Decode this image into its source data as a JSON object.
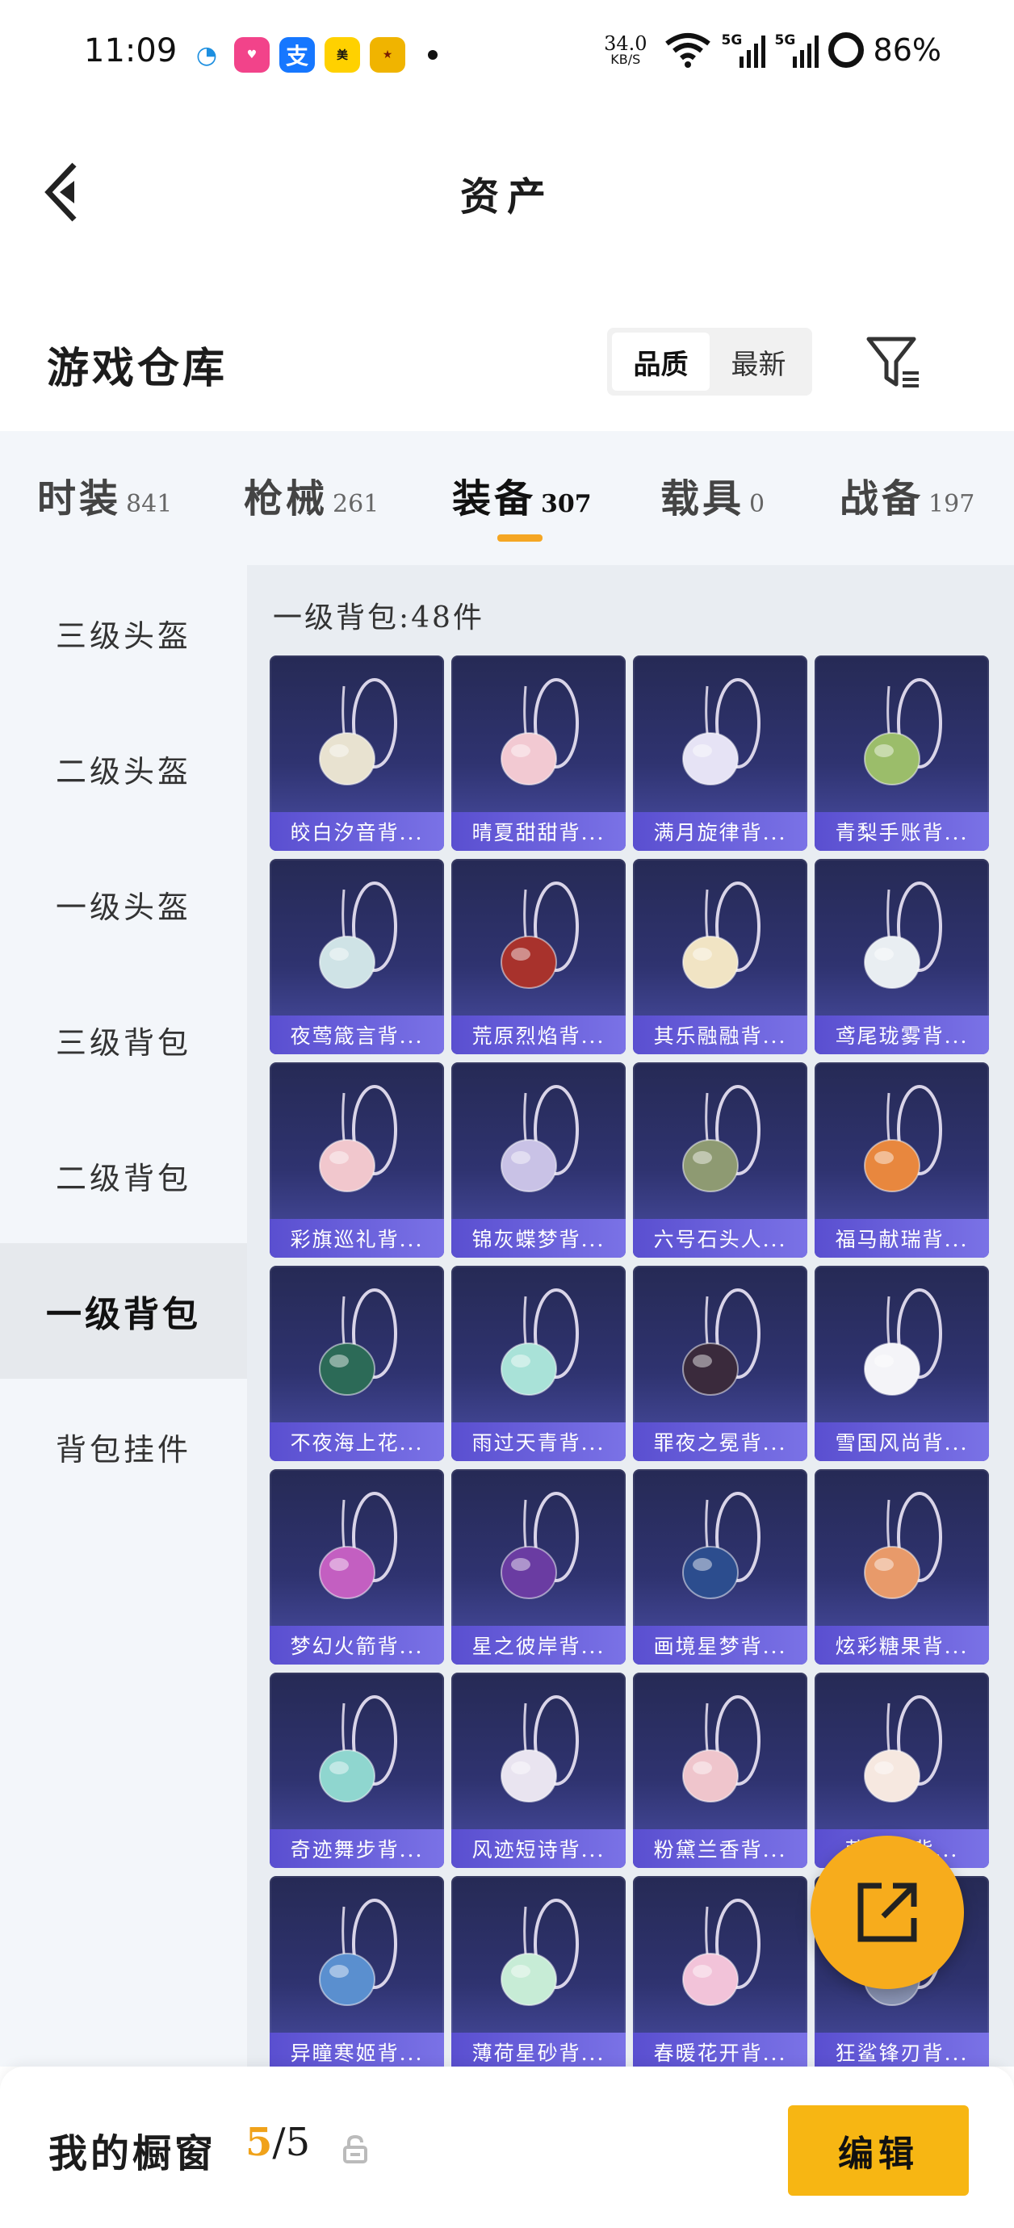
{
  "status_bar": {
    "time": "11:09",
    "net_speed": "34.0",
    "net_unit": "KB/S",
    "sig1": "5G",
    "sig2": "5G",
    "battery": "86%"
  },
  "header": {
    "title": "资产"
  },
  "warehouse": {
    "title": "游戏仓库",
    "sort_options": [
      "品质",
      "最新"
    ],
    "sort_selected": "品质"
  },
  "categories": [
    {
      "name": "时装",
      "count": "841"
    },
    {
      "name": "枪械",
      "count": "261"
    },
    {
      "name": "装备",
      "count": "307",
      "active": true
    },
    {
      "name": "载具",
      "count": "0"
    },
    {
      "name": "战备",
      "count": "197"
    }
  ],
  "sidebar": {
    "items": [
      "三级头盔",
      "二级头盔",
      "一级头盔",
      "三级背包",
      "二级背包",
      "一级背包",
      "背包挂件"
    ],
    "selected": "一级背包"
  },
  "panel": {
    "title": "一级背包:48件",
    "items": [
      {
        "name": "皎白汐音背...",
        "color": "#e8e2d0"
      },
      {
        "name": "晴夏甜甜背...",
        "color": "#f2c9d2"
      },
      {
        "name": "满月旋律背...",
        "color": "#e6e3f5"
      },
      {
        "name": "青梨手账背...",
        "color": "#9bbd6a"
      },
      {
        "name": "夜莺箴言背...",
        "color": "#cfe3e6"
      },
      {
        "name": "荒原烈焰背...",
        "color": "#a8322c"
      },
      {
        "name": "其乐融融背...",
        "color": "#f1e4c4"
      },
      {
        "name": "鸢尾珑雾背...",
        "color": "#e9eef2"
      },
      {
        "name": "彩旗巡礼背...",
        "color": "#f1c7cd"
      },
      {
        "name": "锦灰蝶梦背...",
        "color": "#c9c2e6"
      },
      {
        "name": "六号石头人...",
        "color": "#8e9a72"
      },
      {
        "name": "福马献瑞背...",
        "color": "#e8873e"
      },
      {
        "name": "不夜海上花...",
        "color": "#2c6a57"
      },
      {
        "name": "雨过天青背...",
        "color": "#a9e2d8"
      },
      {
        "name": "罪夜之冕背...",
        "color": "#3a2a3c"
      },
      {
        "name": "雪国风尚背...",
        "color": "#f4f4f8"
      },
      {
        "name": "梦幻火箭背...",
        "color": "#c35fc1"
      },
      {
        "name": "星之彼岸背...",
        "color": "#6a3ca2"
      },
      {
        "name": "画境星梦背...",
        "color": "#2c4d8e"
      },
      {
        "name": "炫彩糖果背...",
        "color": "#e89a6a"
      },
      {
        "name": "奇迹舞步背...",
        "color": "#8fd6cf"
      },
      {
        "name": "风迹短诗背...",
        "color": "#e9e4f0"
      },
      {
        "name": "粉黛兰香背...",
        "color": "#efc5cc"
      },
      {
        "name": "萌萌...背...",
        "color": "#f6e8e0"
      },
      {
        "name": "异瞳寒姬背...",
        "color": "#5a8fcf"
      },
      {
        "name": "薄荷星砂背...",
        "color": "#c7ecd6"
      },
      {
        "name": "春暖花开背...",
        "color": "#f2c3d9"
      },
      {
        "name": "狂鲨锋刃背...",
        "color": "#8a94b4"
      }
    ]
  },
  "bottom": {
    "label": "我的橱窗",
    "current": "5",
    "total": "/5",
    "edit_label": "编辑"
  },
  "colors": {
    "accent": "#f7b613",
    "card_label": "#6a62de"
  }
}
